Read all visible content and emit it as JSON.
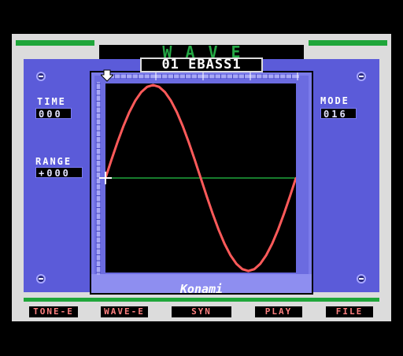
{
  "app": {
    "title": "WAVE EDIT",
    "preset": "01 EBASS1",
    "brand": "Konami"
  },
  "params": {
    "time": {
      "label": "TIME",
      "value": "000"
    },
    "range": {
      "label": "RANGE",
      "value": "+000"
    },
    "mode": {
      "label": "MODE",
      "value": "016"
    }
  },
  "menu": {
    "tone_e": "TONE-E",
    "wave_e": "WAVE-E",
    "syn": "SYN",
    "play": "PLAY",
    "file": "FILE"
  },
  "colors": {
    "panel": "#5b5bd9",
    "accent_green": "#1fa63a",
    "wave": "#ff5a5a",
    "axis": "#1fa63a"
  },
  "chart_data": {
    "type": "line",
    "title": "",
    "series": [
      {
        "samples": [
          0.0,
          0.1951,
          0.3827,
          0.5556,
          0.7071,
          0.8315,
          0.9239,
          0.9808,
          1.0,
          0.9808,
          0.9239,
          0.8315,
          0.7071,
          0.5556,
          0.3827,
          0.1951,
          0.0,
          -0.1951,
          -0.3827,
          -0.5556,
          -0.7071,
          -0.8315,
          -0.9239,
          -0.9808,
          -1.0,
          -0.9808,
          -0.9239,
          -0.8315,
          -0.7071,
          -0.5556,
          -0.3827,
          -0.1951,
          0.0
        ]
      }
    ],
    "ylim": [
      -1,
      1
    ],
    "grid": false
  }
}
